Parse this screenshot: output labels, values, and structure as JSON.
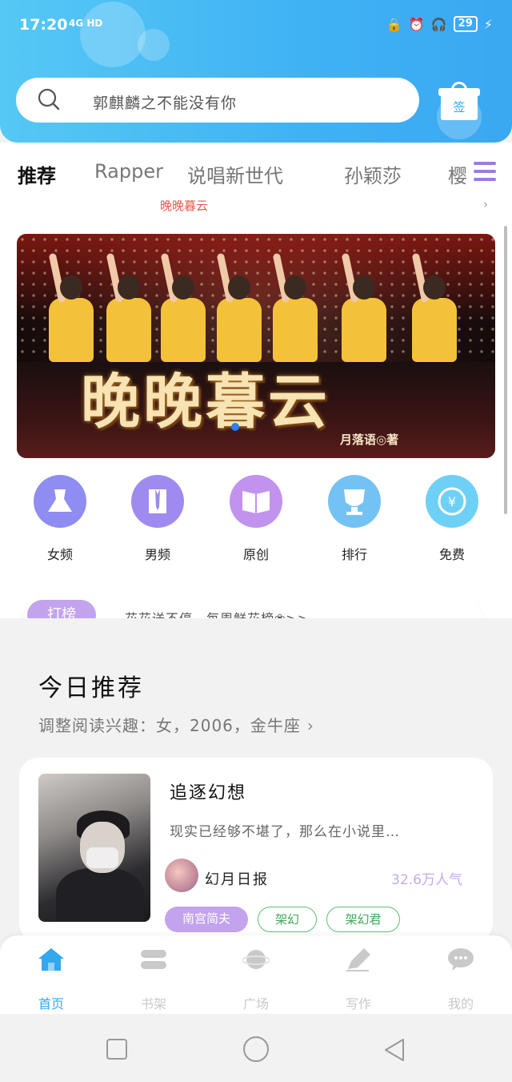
{
  "status_bar": {
    "time": "17:20",
    "network": "4G HD",
    "battery": "29"
  },
  "search": {
    "placeholder": "郭麒麟之不能没有你"
  },
  "gift_button": {
    "label": "签"
  },
  "tabs": [
    {
      "label": "推荐",
      "active": true
    },
    {
      "label": "Rapper",
      "active": false
    },
    {
      "label": "说唱新世代",
      "active": false
    },
    {
      "label": "孙颖莎",
      "active": false
    },
    {
      "label": "樱",
      "active": false
    }
  ],
  "notice": {
    "text": "晚晚暮云"
  },
  "banner": {
    "title": "晚晚暮云",
    "author": "月落语◎著"
  },
  "categories": [
    {
      "label": "女频",
      "icon": "dress-icon",
      "color": "#8f8cf2"
    },
    {
      "label": "男频",
      "icon": "shirt-icon",
      "color": "#9f8bef"
    },
    {
      "label": "原创",
      "icon": "book-icon",
      "color": "#c192ee"
    },
    {
      "label": "排行",
      "icon": "trophy-icon",
      "color": "#74c2f4"
    },
    {
      "label": "免费",
      "icon": "yuan-coin-icon",
      "color": "#6fd0f5"
    }
  ],
  "gift_strip": {
    "button": "打榜",
    "text": "花花送不停，每周鲜花榜❀>>"
  },
  "today": {
    "title": "今日推荐",
    "subtitle": "调整阅读兴趣：女，2006，金牛座"
  },
  "book": {
    "title": "追逐幻想",
    "description": "现实已经够不堪了，那么在小说里…",
    "author": "幻月日报",
    "popularity": "32.6万人气",
    "tags": [
      "南宫简夫",
      "架幻",
      "架幻君"
    ]
  },
  "bottom_nav": [
    {
      "label": "首页",
      "icon": "home-icon",
      "active": true
    },
    {
      "label": "书架",
      "icon": "bookshelf-icon",
      "active": false
    },
    {
      "label": "广场",
      "icon": "planet-icon",
      "active": false
    },
    {
      "label": "写作",
      "icon": "pen-icon",
      "active": false
    },
    {
      "label": "我的",
      "icon": "chat-bubble-icon",
      "active": false
    }
  ],
  "colors": {
    "brand": "#3fb2f4",
    "accent_purple": "#c3a3ee",
    "tag_green": "#5cbf73"
  }
}
